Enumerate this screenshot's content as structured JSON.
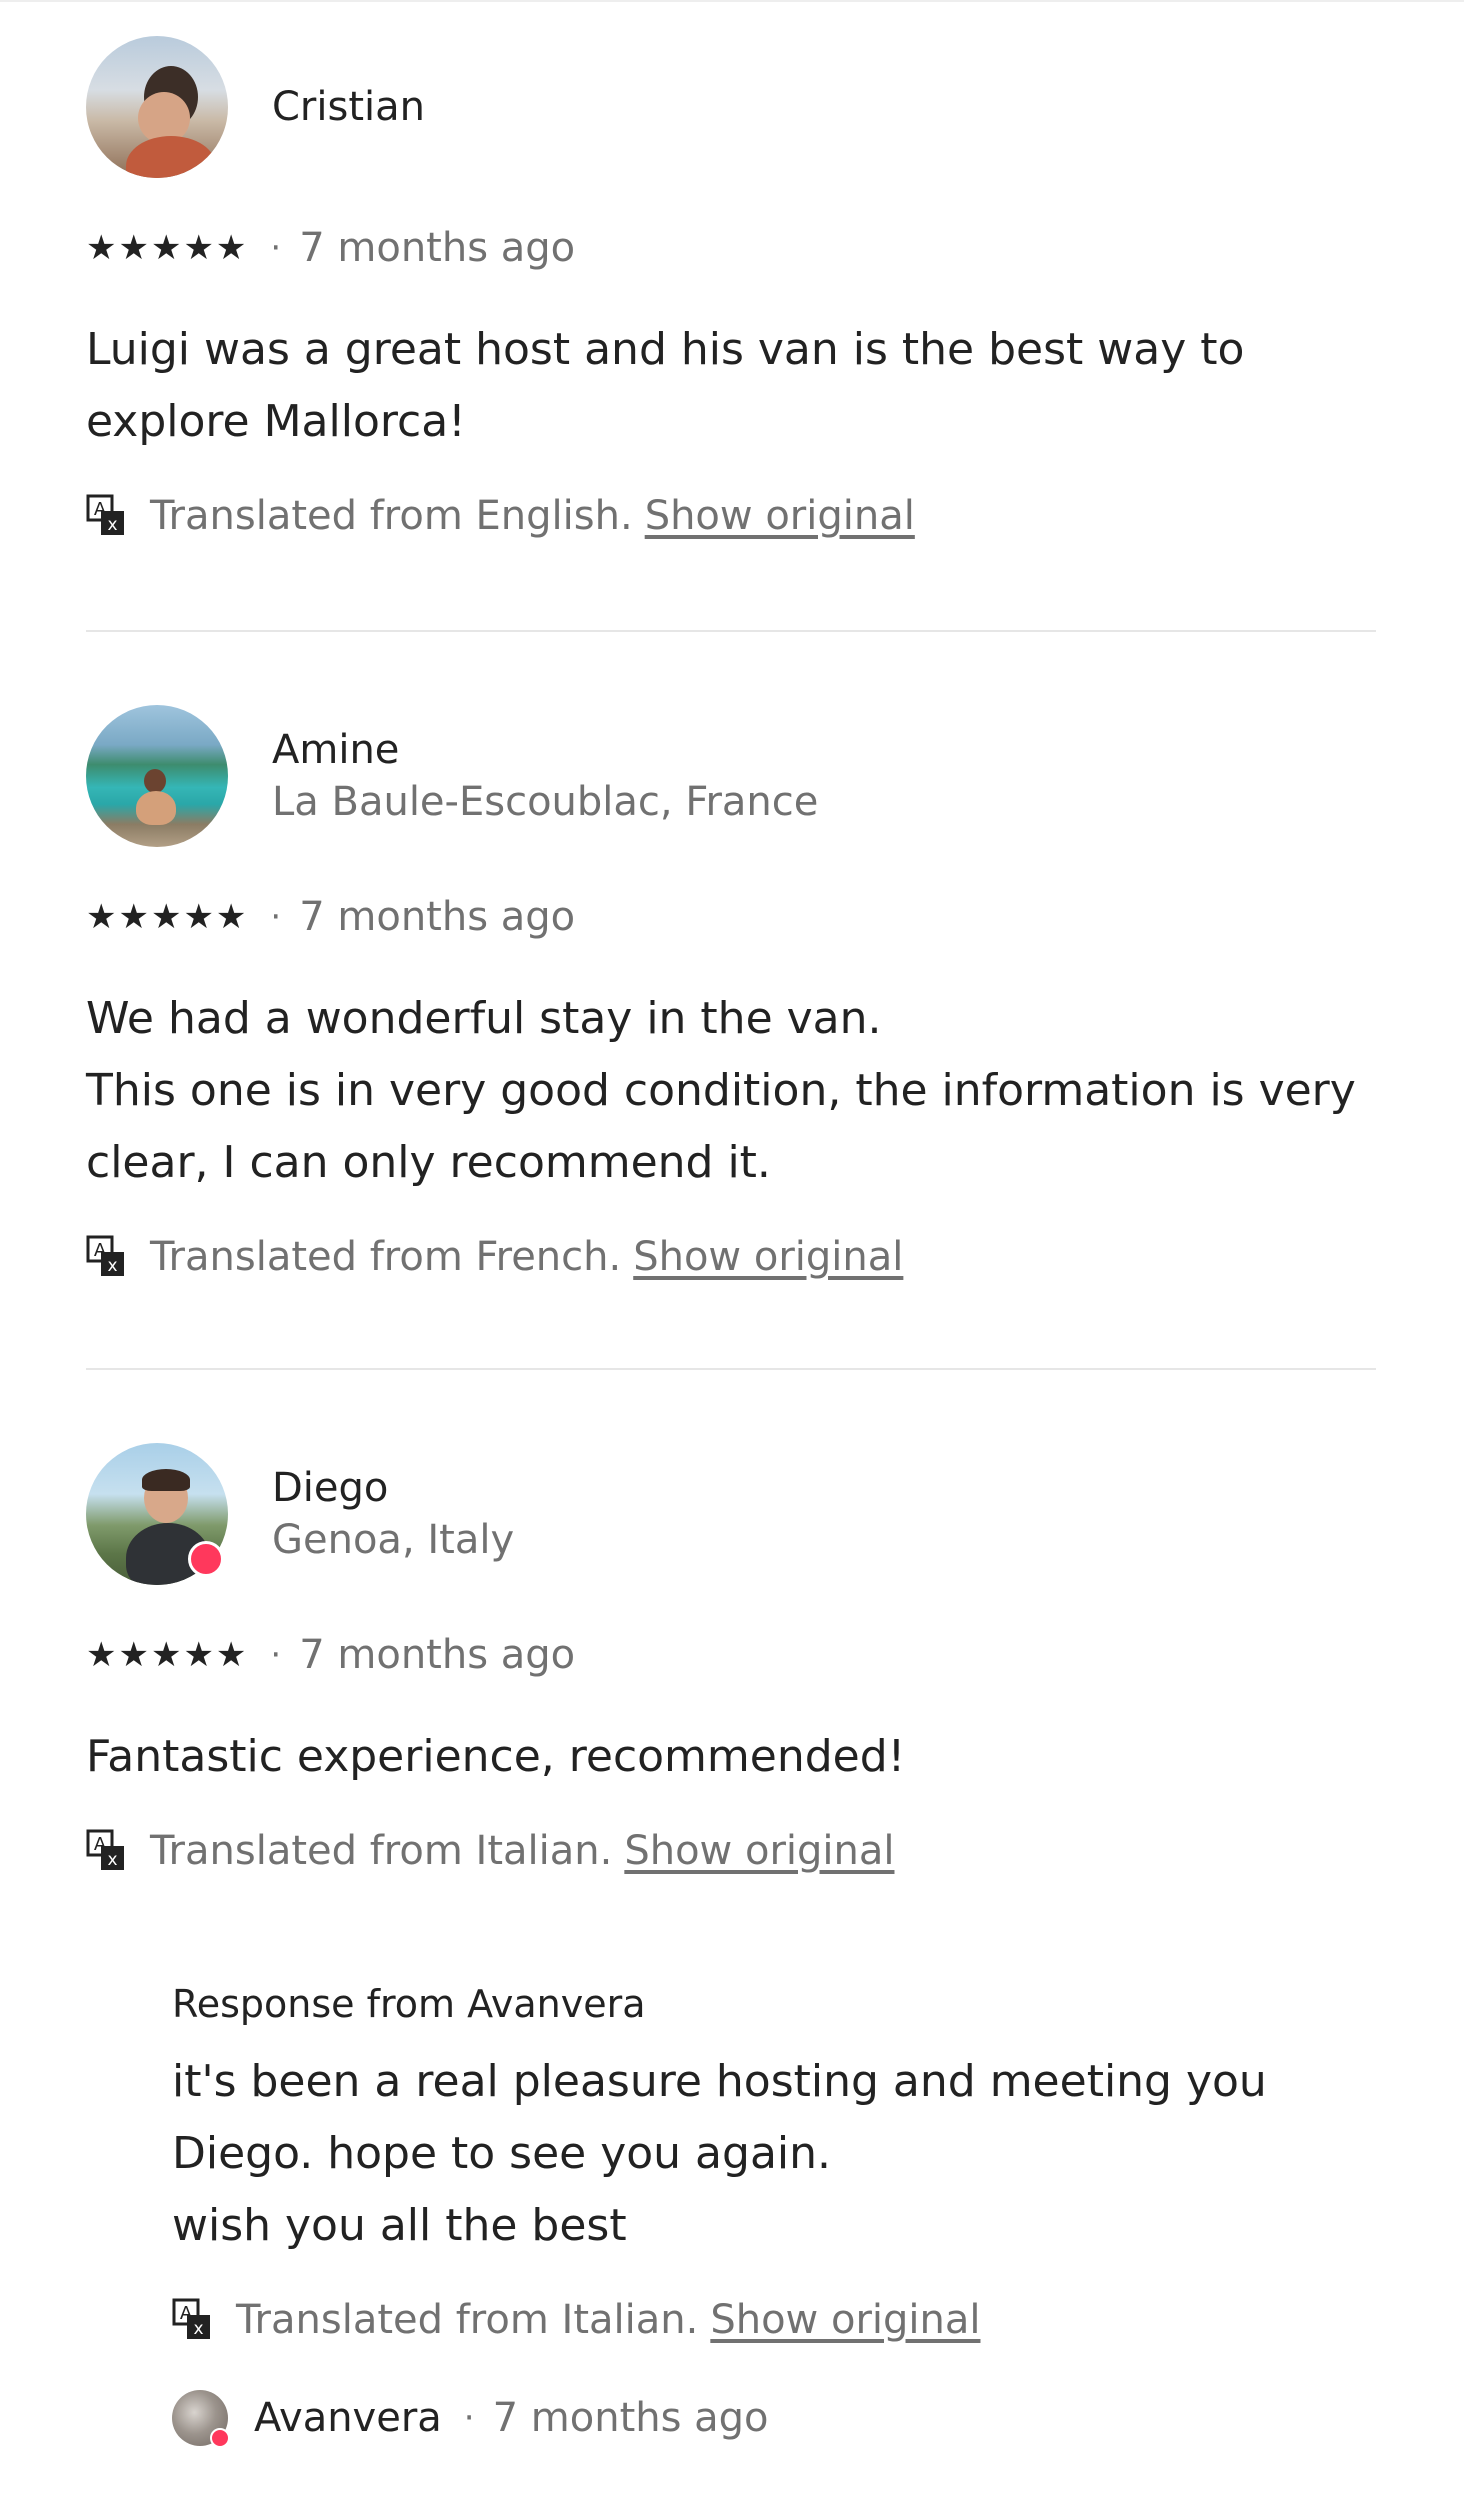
{
  "reviews": [
    {
      "name": "Cristian",
      "location": "",
      "stars": "★★★★★",
      "date": "7 months ago",
      "text": "Luigi was a great host and his van is the best way to\nexplore Mallorca!",
      "translated": "Translated from English.",
      "show_original": "Show original"
    },
    {
      "name": "Amine",
      "location": "La Baule-Escoublac, France",
      "stars": "★★★★★",
      "date": "7 months ago",
      "text": "We had a wonderful stay in the van.\nThis one is in very good condition, the information is very\nclear, I can only recommend it.",
      "translated": "Translated from French.",
      "show_original": "Show original"
    },
    {
      "name": "Diego",
      "location": "Genoa, Italy",
      "stars": "★★★★★",
      "date": "7 months ago",
      "text": "Fantastic experience, recommended!",
      "translated": "Translated from Italian.",
      "show_original": "Show original"
    }
  ],
  "response": {
    "title": "Response from Avanvera",
    "text": "it's been a real pleasure hosting and meeting  you\nDiego. hope to see you again.\nwish you all the best",
    "translated": "Translated from Italian.",
    "show_original": "Show original",
    "host_name": "Avanvera",
    "date": "7 months ago"
  },
  "colors": {
    "text": "#222222",
    "muted": "#717171",
    "divider": "#e6e6e6",
    "badge": "#ff385c"
  },
  "icons": {
    "translate": "translate-icon",
    "star": "star-icon"
  }
}
